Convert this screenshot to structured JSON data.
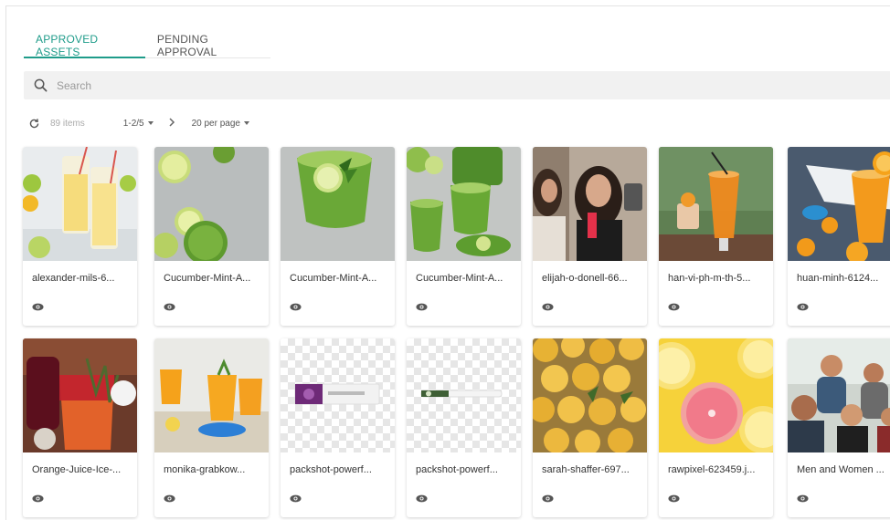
{
  "tabs": [
    {
      "label": "APPROVED ASSETS",
      "active": true
    },
    {
      "label": "PENDING APPROVAL",
      "active": false
    }
  ],
  "search": {
    "placeholder": "Search",
    "value": ""
  },
  "toolbar": {
    "count": "89 items",
    "pages": "1-2/5",
    "per_page": "20 per page"
  },
  "assets": [
    {
      "name": "alexander-mils-6..."
    },
    {
      "name": "Cucumber-Mint-A..."
    },
    {
      "name": "Cucumber-Mint-A..."
    },
    {
      "name": "Cucumber-Mint-A..."
    },
    {
      "name": "elijah-o-donell-66..."
    },
    {
      "name": "han-vi-ph-m-th-5..."
    },
    {
      "name": "huan-minh-6124..."
    },
    {
      "name": "Orange-Juice-Ice-..."
    },
    {
      "name": "monika-grabkow..."
    },
    {
      "name": "packshot-powerf..."
    },
    {
      "name": "packshot-powerf..."
    },
    {
      "name": "sarah-shaffer-697..."
    },
    {
      "name": "rawpixel-623459.j..."
    },
    {
      "name": "Men and Women ..."
    }
  ],
  "colors": {
    "accent": "#1f9c8a",
    "search_bg": "#f1f1f1"
  }
}
